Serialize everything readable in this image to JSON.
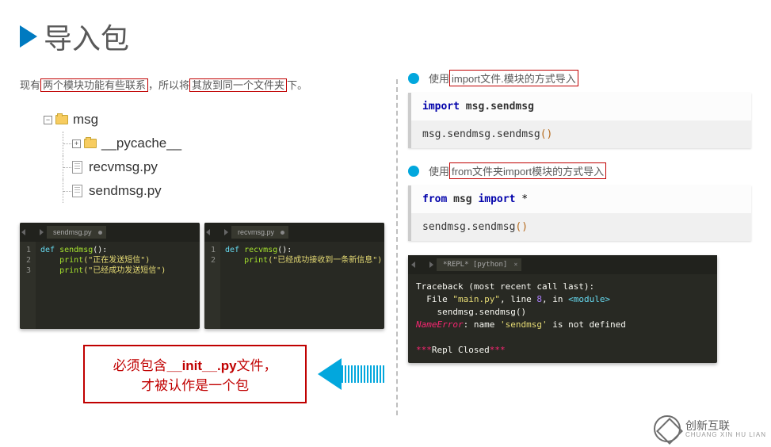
{
  "header": {
    "title": "导入包"
  },
  "left": {
    "intro_pre": "现有",
    "intro_red1": "两个模块功能有些联系",
    "intro_mid": "，所以将",
    "intro_red2": "其放到同一个文件夹",
    "intro_post": "下。",
    "tree": {
      "root": "msg",
      "pycache": "__pycache__",
      "file1": "recvmsg.py",
      "file2": "sendmsg.py"
    },
    "editor1": {
      "tab": "sendmsg.py",
      "l1": "1",
      "l2": "2",
      "l3": "3",
      "c1_kw": "def ",
      "c1_fn": "sendmsg",
      "c1_rest": "():",
      "c2_fn": "    print",
      "c2_str": "(\"正在发送短信\")",
      "c3_fn": "    print",
      "c3_str": "(\"已经成功发送短信\")"
    },
    "editor2": {
      "tab": "recvmsg.py",
      "l1": "1",
      "l2": "2",
      "c1_kw": "def ",
      "c1_fn": "recvmsg",
      "c1_rest": "():",
      "c2_fn": "    print",
      "c2_str": "(\"已经成功接收到一条新信息\")"
    },
    "callout": {
      "line1a": "必须包含",
      "line1b": "__init__.py",
      "line1c": "文件，",
      "line2": "才被认作是一个包"
    }
  },
  "right": {
    "bullet1_pre": "使用",
    "bullet1_red": "import文件.模块的方式导入",
    "card1_top_kw": "import ",
    "card1_top_mod": "msg.sendmsg",
    "card1_bot": "msg.sendmsg.sendmsg",
    "card1_bot_par": "()",
    "bullet2_pre": "使用",
    "bullet2_red": "from文件夹import模块的方式导入",
    "card2_top_kw1": "from ",
    "card2_top_mod": "msg ",
    "card2_top_kw2": "import ",
    "card2_top_star": "*",
    "card2_bot": "sendmsg.sendmsg",
    "card2_bot_par": "()",
    "repl": {
      "tab": "*REPL* [python]",
      "l1": "Traceback (most recent call last):",
      "l2a": "  File ",
      "l2b": "\"main.py\"",
      "l2c": ", line ",
      "l2d": "8",
      "l2e": ", in ",
      "l2f": "<module>",
      "l3": "    sendmsg.sendmsg()",
      "l4a": "NameError",
      "l4b": ": name ",
      "l4c": "'sendmsg'",
      "l4d": " is not defined",
      "l5a": "***",
      "l5b": "Repl Closed",
      "l5c": "***"
    }
  },
  "watermark": {
    "brand": "创新互联",
    "sub": "CHUANG XIN HU LIAN"
  }
}
